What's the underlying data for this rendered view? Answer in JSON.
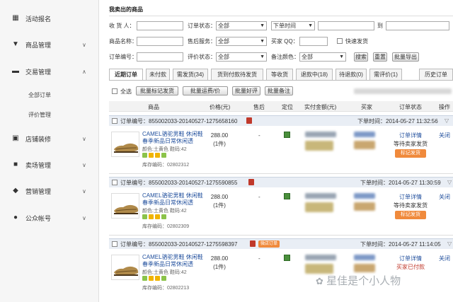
{
  "sidebar": {
    "items": [
      {
        "label": "活动报名",
        "icon": "grid-icon",
        "glyph": "▦",
        "chev": ""
      },
      {
        "label": "商品管理",
        "icon": "tshirt-icon",
        "glyph": "▼",
        "chev": "∨"
      },
      {
        "label": "交易管理",
        "icon": "card-icon",
        "glyph": "▬",
        "chev": "∧"
      },
      {
        "label": "店铺装修",
        "icon": "store-icon",
        "glyph": "▣",
        "chev": "∨"
      },
      {
        "label": "卖场管理",
        "icon": "briefcase-icon",
        "glyph": "■",
        "chev": "∨"
      },
      {
        "label": "营销管理",
        "icon": "tag-icon",
        "glyph": "◆",
        "chev": "∨"
      },
      {
        "label": "公众帐号",
        "icon": "user-icon",
        "glyph": "●",
        "chev": "∨"
      }
    ],
    "sub_items": [
      "全部订单",
      "评价管理"
    ]
  },
  "page_title": "我卖出的商品",
  "filters": {
    "buyer_label": "收 货 人：",
    "order_status_label": "订单状态：",
    "order_status_value": "全部",
    "order_time_value": "下单时间",
    "to_label": "到",
    "product_name_label": "商品名称：",
    "after_sale_label": "售后服务：",
    "after_sale_value": "全部",
    "buyer_qq_label": "买家 QQ：",
    "fast_ship_label": "快速发货",
    "order_no_label": "订单编号：",
    "review_status_label": "评价状态：",
    "review_status_value": "全部",
    "note_color_label": "备注颜色：",
    "note_color_value": "全部",
    "search_btn": "搜索",
    "reset_btn": "重置",
    "export_btn": "批量导出"
  },
  "tabs": [
    "近期订单",
    "未付款",
    "需发货(34)",
    "货到付款待发货",
    "等收货",
    "退款中(18)",
    "待退款(0)",
    "需评价(1)",
    "历史订单"
  ],
  "bulk": {
    "select_all": "全选",
    "mark_ship": "批量标记发货",
    "freight": "批量运费/价",
    "good_review": "批量好评",
    "remark": "批量备注"
  },
  "columns": [
    "商品",
    "价格(元)",
    "售后",
    "定位",
    "实付金额(元)",
    "买家",
    "订单状态",
    "操作"
  ],
  "orders": [
    {
      "id": "订单编号：855002033-20140527-1275658160",
      "time": "下单时间：2014-05-27 11:32:56",
      "tag": "",
      "title": "CAMEL骆驼男鞋 休闲鞋春季新品日常休闲透",
      "color": "颜色:土黄色  鞋码:42",
      "stock": "库存编码：02802312",
      "price": "288.00",
      "qty": "(1件)",
      "aftersale": "-",
      "status": "订单详情",
      "status2": "等待卖家发货",
      "action_btn": "标记发货",
      "close": "关闭"
    },
    {
      "id": "订单编号：855002033-20140527-1275590855",
      "time": "下单时间：2014-05-27 11:30:59",
      "tag": "",
      "title": "CAMEL骆驼男鞋 休闲鞋春季新品日常休闲透",
      "color": "颜色:土黄色  鞋码:42",
      "stock": "库存编码：02802309",
      "price": "288.00",
      "qty": "(1件)",
      "aftersale": "-",
      "status": "订单详情",
      "status2": "等待卖家发货",
      "action_btn": "标记发货",
      "close": "关闭"
    },
    {
      "id": "订单编号：855002033-20140527-1275598397",
      "time": "下单时间：2014-05-27 11:14:05",
      "tag": "微店订单",
      "title": "CAMEL骆驼男鞋 休闲鞋春季新品日常休闲透",
      "color": "颜色:土黄色  鞋码:42",
      "stock": "库存编码：02802213",
      "price": "288.00",
      "qty": "(1件)",
      "aftersale": "-",
      "status": "订单详情",
      "status2": "买家已付款",
      "action_btn": "",
      "close": "关闭"
    }
  ],
  "watermark": "星佳是个小人物",
  "colors": {
    "accent_orange": "#f08a3c",
    "link_blue": "#1f4e9c",
    "lock_red": "#c0392b"
  }
}
